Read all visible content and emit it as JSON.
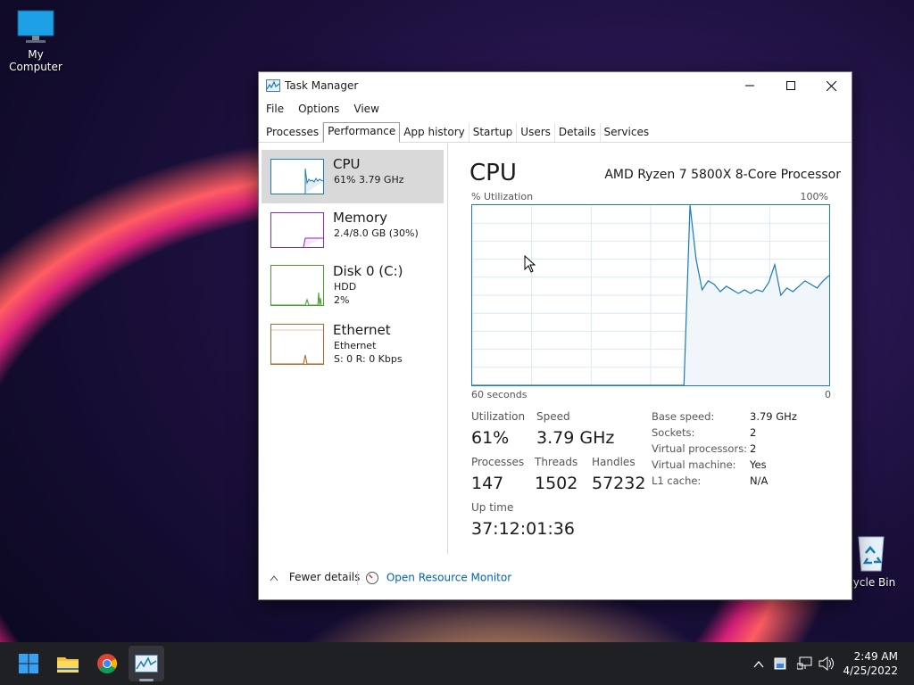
{
  "desktop": {
    "my_computer_label": "My Computer",
    "recycle_bin_label": "Recycle Bin"
  },
  "window": {
    "title": "Task Manager",
    "menu": [
      "File",
      "Options",
      "View"
    ],
    "tabs": [
      "Processes",
      "Performance",
      "App history",
      "Startup",
      "Users",
      "Details",
      "Services"
    ],
    "active_tab": "Performance"
  },
  "resources": [
    {
      "name": "CPU",
      "line1": "61% 3.79 GHz",
      "line2": "",
      "color": "#1b7bb3",
      "selected": true
    },
    {
      "name": "Memory",
      "line1": "2.4/8.0 GB (30%)",
      "line2": "",
      "color": "#8b2fb0",
      "selected": false
    },
    {
      "name": "Disk 0 (C:)",
      "line1": "HDD",
      "line2": "2%",
      "color": "#4aa02c",
      "selected": false
    },
    {
      "name": "Ethernet",
      "line1": "Ethernet",
      "line2": "S: 0 R: 0 Kbps",
      "color": "#a7672a",
      "selected": false
    }
  ],
  "detail": {
    "title": "CPU",
    "processor": "AMD Ryzen 7 5800X 8-Core Processor",
    "y_label": "% Utilization",
    "y_max": "100%",
    "x_left": "60 seconds",
    "x_right": "0",
    "stats": {
      "utilization_label": "Utilization",
      "utilization": "61%",
      "speed_label": "Speed",
      "speed": "3.79 GHz",
      "processes_label": "Processes",
      "processes": "147",
      "threads_label": "Threads",
      "threads": "1502",
      "handles_label": "Handles",
      "handles": "57232",
      "uptime_label": "Up time",
      "uptime": "37:12:01:36"
    },
    "specs": [
      {
        "k": "Base speed:",
        "v": "3.79 GHz"
      },
      {
        "k": "Sockets:",
        "v": "2"
      },
      {
        "k": "Virtual processors:",
        "v": "2"
      },
      {
        "k": "Virtual machine:",
        "v": "Yes"
      },
      {
        "k": "L1 cache:",
        "v": "N/A"
      }
    ]
  },
  "cpu_history": [
    0,
    0,
    0,
    0,
    0,
    0,
    0,
    0,
    0,
    0,
    0,
    0,
    0,
    0,
    0,
    0,
    0,
    0,
    0,
    0,
    0,
    0,
    0,
    0,
    0,
    0,
    0,
    0,
    0,
    0,
    0,
    0,
    0,
    0,
    0,
    0,
    100,
    70,
    53,
    58,
    56,
    52,
    55,
    53,
    51,
    53,
    51,
    53,
    52,
    57,
    67,
    50,
    54,
    52,
    55,
    58,
    56,
    54,
    58,
    61
  ],
  "footer": {
    "fewer_details": "Fewer details",
    "open_resource_monitor": "Open Resource Monitor"
  },
  "taskbar": {
    "time": "2:49 AM",
    "date": "4/25/2022"
  },
  "colors": {
    "cpu_line": "#1b7bb3",
    "cpu_fill": "#f1f6fb",
    "taskbar": "#1f2023"
  }
}
